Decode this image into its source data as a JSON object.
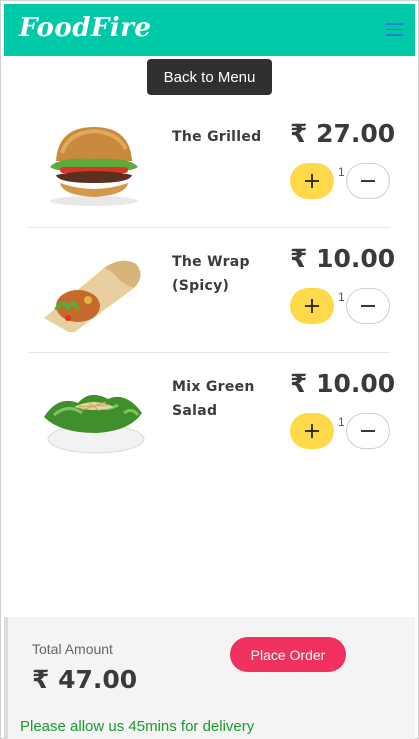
{
  "header": {
    "brand": "FoodFire",
    "menu_icon": "hamburger-icon",
    "accent": "#00c9a7"
  },
  "back_button": {
    "label": "Back to Menu"
  },
  "cart": {
    "items": [
      {
        "name": "The Grilled",
        "price": "₹ 27.00",
        "quantity": "1",
        "image": "burger-image"
      },
      {
        "name": "The Wrap (Spicy)",
        "price": "₹ 10.00",
        "quantity": "1",
        "image": "wrap-image"
      },
      {
        "name": "Mix Green Salad",
        "price": "₹ 10.00",
        "quantity": "1",
        "image": "salad-image"
      }
    ],
    "plus_icon": "plus-icon",
    "minus_icon": "minus-icon",
    "plus_color": "#ffd94a"
  },
  "footer": {
    "total_label": "Total Amount",
    "total_value": "₹ 47.00",
    "place_order_label": "Place Order",
    "place_order_color": "#f0315f",
    "delivery_note": "Please allow us 45mins for delivery",
    "delivery_color": "#1a9c2c"
  }
}
